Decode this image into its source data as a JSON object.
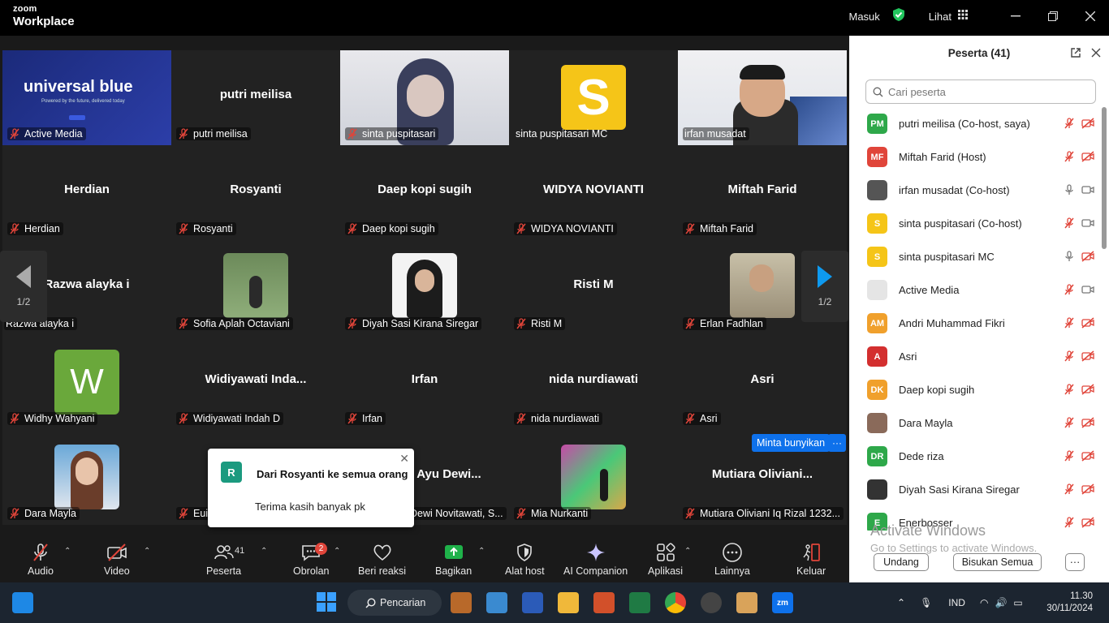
{
  "titlebar": {
    "brand_top": "zoom",
    "brand_bottom": "Workplace",
    "signin": "Masuk",
    "view": "Lihat"
  },
  "gallery": {
    "page_left": "1/2",
    "page_right": "1/2",
    "tiles": [
      {
        "label": "Active Media",
        "center": ""
      },
      {
        "label": "putri meilisa",
        "center": "putri meilisa"
      },
      {
        "label": "sinta puspitasari",
        "center": ""
      },
      {
        "label": "sinta puspitasari MC",
        "center": ""
      },
      {
        "label": "irfan musadat",
        "center": ""
      },
      {
        "label": "Herdian",
        "center": "Herdian"
      },
      {
        "label": "Rosyanti",
        "center": "Rosyanti"
      },
      {
        "label": "Daep kopi sugih",
        "center": "Daep kopi sugih"
      },
      {
        "label": "WIDYA NOVIANTI",
        "center": "WIDYA NOVIANTI"
      },
      {
        "label": "Miftah Farid",
        "center": "Miftah Farid"
      },
      {
        "label": "Razwa alayka i",
        "center": "Razwa alayka i"
      },
      {
        "label": "Sofia Aplah Octaviani",
        "center": ""
      },
      {
        "label": "Diyah Sasi Kirana Siregar",
        "center": ""
      },
      {
        "label": "Risti M",
        "center": "Risti M"
      },
      {
        "label": "Erlan Fadhlan",
        "center": ""
      },
      {
        "label": "Widhy Wahyani",
        "center": ""
      },
      {
        "label": "Widiyawati Indah D",
        "center": "Widiyawati  Inda..."
      },
      {
        "label": "Irfan",
        "center": "Irfan"
      },
      {
        "label": "nida nurdiawati",
        "center": "nida nurdiawati"
      },
      {
        "label": "Asri",
        "center": "Asri"
      },
      {
        "label": "Dara Mayla",
        "center": ""
      },
      {
        "label": "Euis",
        "center": ""
      },
      {
        "label": "Dewi Novitawati, S...",
        "center": "Ayu  Dewi..."
      },
      {
        "label": "Mia Nurkanti",
        "center": ""
      },
      {
        "label": "Mutiara Oliviani Iq Rizal 1232...",
        "center": "Mutiara  Oliviani..."
      }
    ],
    "avatar_letter_s": "S",
    "avatar_letter_w": "W",
    "active_media_logo": "universal blue",
    "active_media_tagline": "Powered by the future, delivered today",
    "request_unmute": "Minta bunyikan",
    "more": "···"
  },
  "toast": {
    "avatar": "R",
    "from": "Dari Rosyanti ke semua orang",
    "message": "Terima kasih banyak pk"
  },
  "toolbar": {
    "audio": "Audio",
    "video": "Video",
    "participants": "Peserta",
    "participants_count": "41",
    "chat": "Obrolan",
    "chat_badge": "2",
    "react": "Beri reaksi",
    "share": "Bagikan",
    "security": "Alat host",
    "ai": "AI Companion",
    "apps": "Aplikasi",
    "more": "Lainnya",
    "leave": "Keluar"
  },
  "panel": {
    "title": "Peserta (41)",
    "search_placeholder": "Cari peserta",
    "participants": [
      {
        "initials": "PM",
        "name": "putri meilisa (Co-host, saya)",
        "color": "#2ea84a"
      },
      {
        "initials": "MF",
        "name": "Miftah Farid (Host)",
        "color": "#e0453a"
      },
      {
        "initials": "",
        "name": "irfan musadat (Co-host)",
        "color": "#555555"
      },
      {
        "initials": "S",
        "name": "sinta puspitasari (Co-host)",
        "color": "#f5c518"
      },
      {
        "initials": "S",
        "name": "sinta puspitasari MC",
        "color": "#f5c518"
      },
      {
        "initials": "",
        "name": "Active Media",
        "color": "#e5e5e5"
      },
      {
        "initials": "AM",
        "name": "Andri Muhammad Fikri",
        "color": "#f0a02c"
      },
      {
        "initials": "A",
        "name": "Asri",
        "color": "#d32f2f"
      },
      {
        "initials": "DK",
        "name": "Daep kopi sugih",
        "color": "#f0a02c"
      },
      {
        "initials": "",
        "name": "Dara Mayla",
        "color": "#8a6a5a"
      },
      {
        "initials": "DR",
        "name": "Dede riza",
        "color": "#2ea84a"
      },
      {
        "initials": "",
        "name": "Diyah Sasi Kirana Siregar",
        "color": "#333333"
      },
      {
        "initials": "E",
        "name": "Enerbosser",
        "color": "#2ea84a"
      }
    ],
    "watermark": "Activate Windows",
    "watermark_sub": "Go to Settings to activate Windows.",
    "invite": "Undang",
    "mute_all": "Bisukan Semua",
    "more": "···"
  },
  "taskbar": {
    "search": "Pencarian",
    "lang": "IND",
    "time": "11.30",
    "date": "30/11/2024"
  },
  "colors": {
    "accent": "#0e71eb",
    "muted_red": "#e0453a",
    "active_border": "#22c55e"
  }
}
